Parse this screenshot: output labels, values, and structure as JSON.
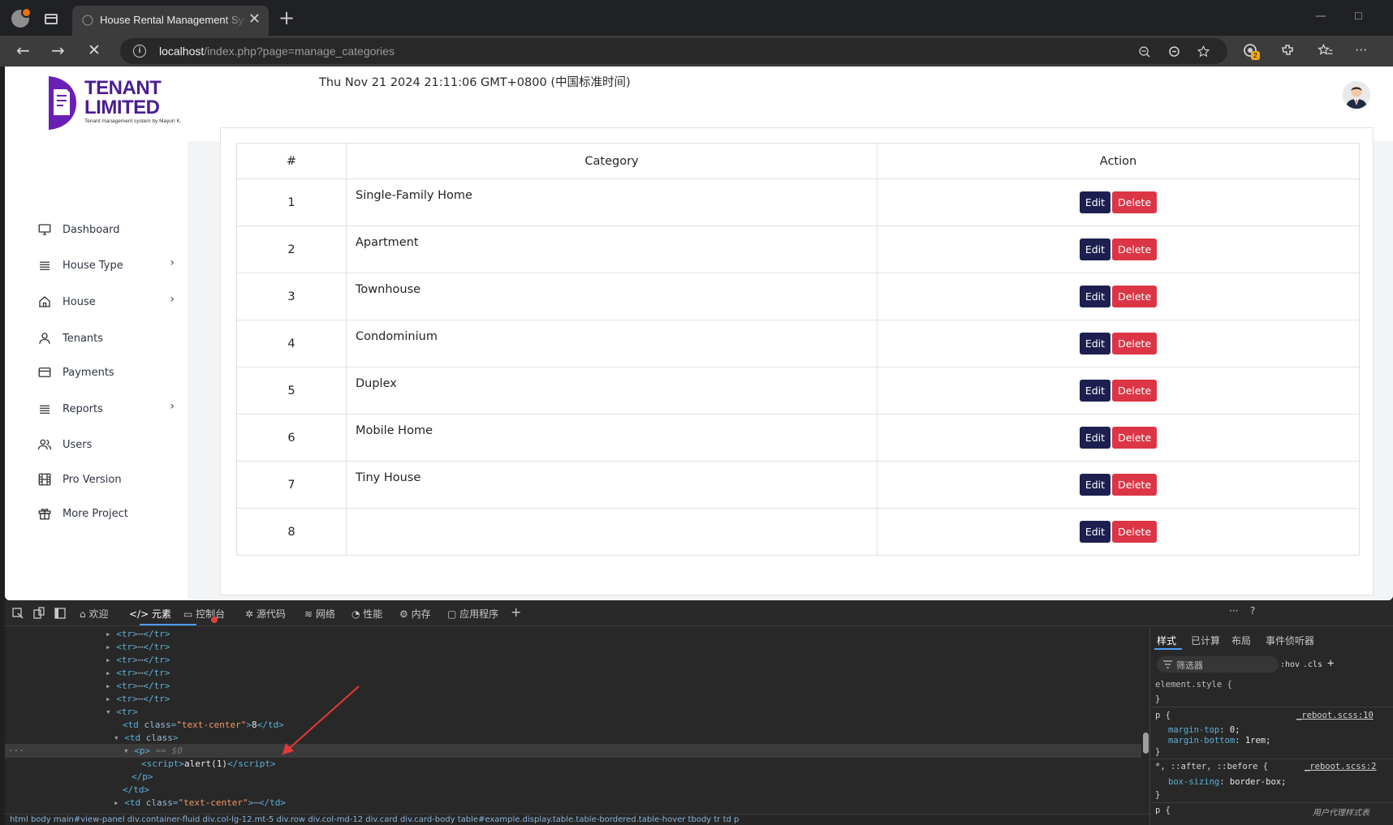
{
  "browser": {
    "tab_title": "House Rental Management Syste",
    "tab_close": "✕",
    "new_tab": "+",
    "url_host": "localhost",
    "url_path": "/index.php?page=manage_categories",
    "icons": [
      "back-icon",
      "forward-icon",
      "stop-icon",
      "info-icon",
      "zoom-out-icon",
      "read-aloud-icon",
      "favorite-icon",
      "copilot-icon",
      "extensions-icon",
      "favorites-list-icon",
      "more-icon"
    ],
    "extension_badge": "2"
  },
  "header": {
    "logo_line1": "TENANT",
    "logo_line2": "LIMITED",
    "logo_tagline": "Tenant management system by Mayuri K.",
    "datetime": "Thu Nov 21 2024 21:11:06 GMT+0800 (中国标准时间)"
  },
  "sidebar": {
    "items": [
      {
        "label": "Dashboard",
        "icon": "monitor-icon",
        "has_sub": false
      },
      {
        "label": "House Type",
        "icon": "list-icon",
        "has_sub": true
      },
      {
        "label": "House",
        "icon": "home-icon",
        "has_sub": true
      },
      {
        "label": "Tenants",
        "icon": "user-icon",
        "has_sub": false
      },
      {
        "label": "Payments",
        "icon": "credit-card-icon",
        "has_sub": false
      },
      {
        "label": "Reports",
        "icon": "list-icon",
        "has_sub": true
      },
      {
        "label": "Users",
        "icon": "users-icon",
        "has_sub": false
      },
      {
        "label": "Pro Version",
        "icon": "film-icon",
        "has_sub": false
      },
      {
        "label": "More Project",
        "icon": "gift-icon",
        "has_sub": false
      }
    ],
    "chevron": "›"
  },
  "table": {
    "headers": [
      "#",
      "Category",
      "Action"
    ],
    "rows": [
      {
        "num": "1",
        "category": "Single-Family Home"
      },
      {
        "num": "2",
        "category": "Apartment"
      },
      {
        "num": "3",
        "category": "Townhouse"
      },
      {
        "num": "4",
        "category": "Condominium"
      },
      {
        "num": "5",
        "category": "Duplex"
      },
      {
        "num": "6",
        "category": "Mobile Home"
      },
      {
        "num": "7",
        "category": "Tiny House"
      },
      {
        "num": "8",
        "category": ""
      }
    ],
    "edit_label": "Edit",
    "delete_label": "Delete"
  },
  "devtools": {
    "tools": [
      "欢迎",
      "元素",
      "控制台",
      "源代码",
      "网络",
      "性能",
      "内存",
      "应用程序"
    ],
    "active_tool": "元素",
    "dom_lines": [
      {
        "indent": 0,
        "kind": "collapsed"
      },
      {
        "indent": 0,
        "kind": "collapsed"
      },
      {
        "indent": 0,
        "kind": "collapsed"
      },
      {
        "indent": 0,
        "kind": "collapsed"
      },
      {
        "indent": 0,
        "kind": "collapsed"
      },
      {
        "indent": 0,
        "kind": "collapsed"
      },
      {
        "indent": 0,
        "kind": "open-tr"
      },
      {
        "indent": 1,
        "kind": "td-center",
        "text": "8"
      },
      {
        "indent": 1,
        "kind": "td-class"
      },
      {
        "indent": 2,
        "kind": "p-selected",
        "text": "== $0"
      },
      {
        "indent": 3,
        "kind": "script",
        "text": "alert(1)"
      },
      {
        "indent": 2,
        "kind": "close-p"
      },
      {
        "indent": 1,
        "kind": "close-td"
      },
      {
        "indent": 1,
        "kind": "td-center-collapsed"
      }
    ],
    "breadcrumb": "html   body   main#view-panel   div.container-fluid   div.col-lg-12.mt-5   div.row   div.col-md-12   div.card   div.card-body   table#example.display.table.table-bordered.table-hover   tbody   tr   td   p",
    "styles_tabs": [
      "样式",
      "已计算",
      "布局",
      "事件侦听器"
    ],
    "filter_placeholder": "筛选器",
    "hov": ":hov",
    "cls": ".cls",
    "rules": {
      "element_style": "element.style {",
      "close": "}",
      "p_selector": "p {",
      "p_source": "_reboot.scss:10",
      "p_props": [
        {
          "name": "margin-top",
          "value": "0;"
        },
        {
          "name": "margin-bottom",
          "value": "1rem;"
        }
      ],
      "star_selector": "*, ::after, ::before {",
      "star_source": "_reboot.scss:2",
      "star_props": [
        {
          "name": "box-sizing",
          "value": "border-box;"
        }
      ],
      "p2_selector": "p {",
      "user_agent": "用户代理样式表"
    }
  }
}
